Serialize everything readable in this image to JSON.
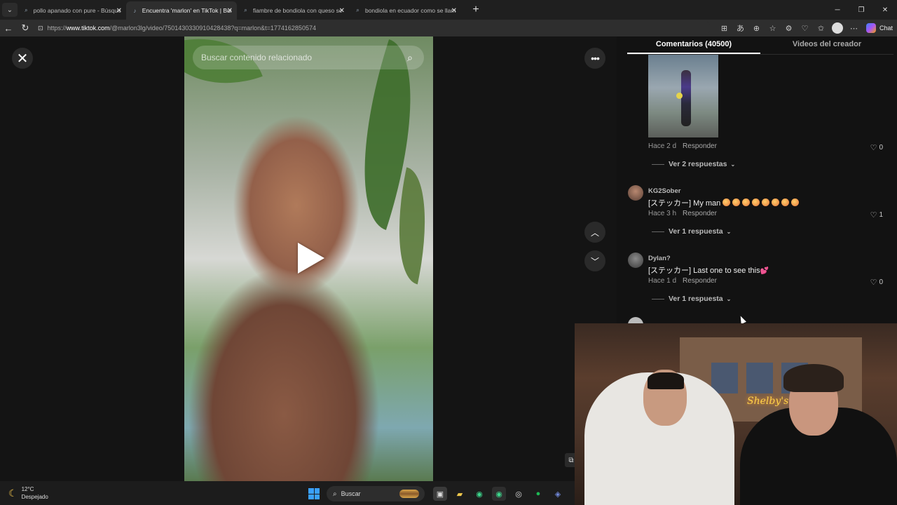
{
  "browser": {
    "tabs": [
      {
        "title": "pollo apanado con pure - Búsqued",
        "active": false,
        "icon": "search-icon"
      },
      {
        "title": "Encuentra 'marlon' en TikTok | Bus",
        "active": true,
        "icon": "tiktok-icon"
      },
      {
        "title": "fiambre de bondiola con queso se",
        "active": false,
        "icon": "search-icon"
      },
      {
        "title": "bondiola en ecuador como se llam",
        "active": false,
        "icon": "search-icon"
      }
    ],
    "url_prefix": "https://",
    "url_domain": "www.tiktok.com",
    "url_path": "/@marlon3lg/video/7501430330910428438?q=marlon&t=1774162850574",
    "chat_label": "Chat"
  },
  "video": {
    "search_placeholder": "Buscar contenido relacionado"
  },
  "panel": {
    "tabs": [
      "Comentarios (40500)",
      "Videos del creador"
    ],
    "comments": [
      {
        "time": "Hace 2 d",
        "reply_label": "Responder",
        "likes": "0",
        "view_replies": "Ver 2 respuestas"
      },
      {
        "username": "KG2Sober",
        "text": "[ステッカー] My man",
        "time": "Hace 3 h",
        "reply_label": "Responder",
        "likes": "1",
        "view_replies": "Ver 1 respuesta"
      },
      {
        "username": "Dylan?",
        "text": "[ステッカー] Last one to see this",
        "time": "Hace 1 d",
        "reply_label": "Responder",
        "likes": "0",
        "view_replies": "Ver 1 respuesta"
      }
    ]
  },
  "webcam": {
    "neon_text": "Shelby's"
  },
  "taskbar": {
    "temperature": "12°C",
    "condition": "Despejado",
    "search_label": "Buscar"
  }
}
